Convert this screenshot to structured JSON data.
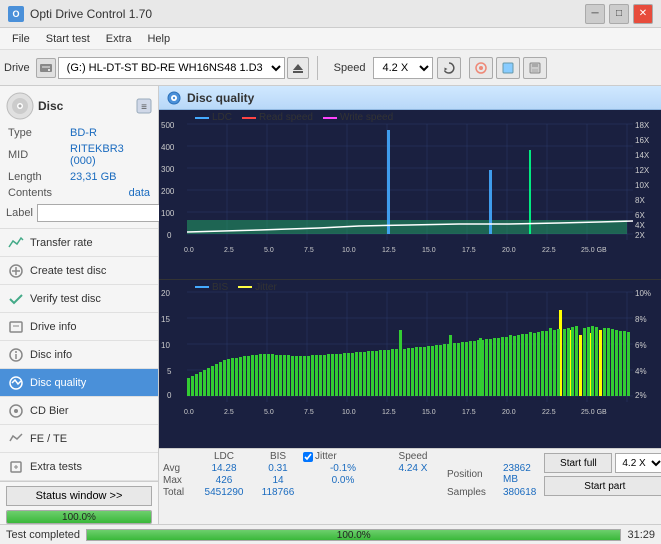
{
  "titlebar": {
    "title": "Opti Drive Control 1.70",
    "minimize": "─",
    "maximize": "□",
    "close": "✕"
  },
  "menubar": {
    "items": [
      "File",
      "Start test",
      "Extra",
      "Help"
    ]
  },
  "toolbar": {
    "drive_label": "Drive",
    "drive_value": "(G:) HL-DT-ST BD-RE  WH16NS48 1.D3",
    "speed_label": "Speed",
    "speed_value": "4.2 X"
  },
  "disc": {
    "header": "Disc",
    "type_label": "Type",
    "type_value": "BD-R",
    "mid_label": "MID",
    "mid_value": "RITEKBR3 (000)",
    "length_label": "Length",
    "length_value": "23,31 GB",
    "contents_label": "Contents",
    "contents_value": "data",
    "label_label": "Label",
    "label_placeholder": ""
  },
  "nav": {
    "items": [
      {
        "id": "transfer-rate",
        "label": "Transfer rate",
        "active": false
      },
      {
        "id": "create-test-disc",
        "label": "Create test disc",
        "active": false
      },
      {
        "id": "verify-test-disc",
        "label": "Verify test disc",
        "active": false
      },
      {
        "id": "drive-info",
        "label": "Drive info",
        "active": false
      },
      {
        "id": "disc-info",
        "label": "Disc info",
        "active": false
      },
      {
        "id": "disc-quality",
        "label": "Disc quality",
        "active": true
      },
      {
        "id": "cd-bier",
        "label": "CD Bier",
        "active": false
      },
      {
        "id": "fe-te",
        "label": "FE / TE",
        "active": false
      },
      {
        "id": "extra-tests",
        "label": "Extra tests",
        "active": false
      }
    ]
  },
  "status_window_btn": "Status window >>",
  "progress": {
    "value": 100,
    "text": "100.0%"
  },
  "status_text": "Test completed",
  "time_text": "31:29",
  "disc_quality": {
    "title": "Disc quality",
    "legend_top": [
      "LDC",
      "Read speed",
      "Write speed"
    ],
    "legend_bottom": [
      "BIS",
      "Jitter"
    ],
    "chart_top": {
      "y_max": 500,
      "y_labels": [
        "500",
        "400",
        "300",
        "200",
        "100",
        "0"
      ],
      "y_right_labels": [
        "18X",
        "16X",
        "14X",
        "12X",
        "10X",
        "8X",
        "6X",
        "4X",
        "2X"
      ],
      "x_max": 25,
      "x_labels": [
        "0.0",
        "2.5",
        "5.0",
        "7.5",
        "10.0",
        "12.5",
        "15.0",
        "17.5",
        "20.0",
        "22.5",
        "25.0 GB"
      ]
    },
    "chart_bottom": {
      "y_max": 20,
      "y_labels": [
        "20",
        "15",
        "10",
        "5",
        "0"
      ],
      "y_right_labels": [
        "10%",
        "8%",
        "6%",
        "4%",
        "2%"
      ],
      "x_max": 25,
      "x_labels": [
        "0.0",
        "2.5",
        "5.0",
        "7.5",
        "10.0",
        "12.5",
        "15.0",
        "17.5",
        "20.0",
        "22.5",
        "25.0 GB"
      ]
    }
  },
  "stats": {
    "ldc_header": "LDC",
    "bis_header": "BIS",
    "jitter_header": "Jitter",
    "speed_header": "Speed",
    "avg_label": "Avg",
    "max_label": "Max",
    "total_label": "Total",
    "avg_ldc": "14.28",
    "avg_bis": "0.31",
    "avg_jitter": "-0.1%",
    "avg_speed": "4.24 X",
    "max_ldc": "426",
    "max_bis": "14",
    "max_jitter": "0.0%",
    "total_ldc": "5451290",
    "total_bis": "118766",
    "position_label": "Position",
    "position_val": "23862 MB",
    "samples_label": "Samples",
    "samples_val": "380618",
    "start_full_btn": "Start full",
    "start_part_btn": "Start part",
    "speed_select": "4.2 X"
  }
}
